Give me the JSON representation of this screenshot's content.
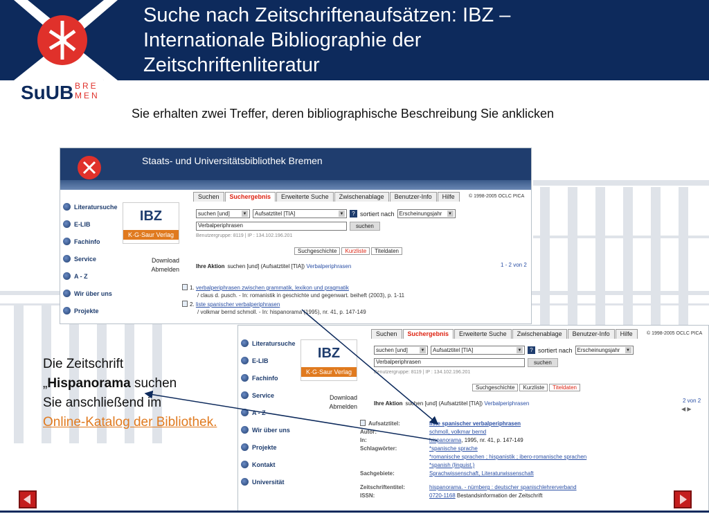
{
  "slide": {
    "title_lines": [
      "Suche nach Zeitschriftenaufsätzen: IBZ –",
      "Internationale Bibliographie der",
      "Zeitschriftenliteratur"
    ],
    "subtitle": "Sie erhalten zwei Treffer, deren bibliographische Beschreibung Sie anklicken",
    "logo": {
      "su": "SuUB",
      "bre": "BRE",
      "men": "MEN"
    },
    "note": {
      "line1": "Die Zeitschrift",
      "quote_open": "„",
      "bold": "Hispanorama",
      "line2_rest": " suchen",
      "line3": "Sie anschließend im",
      "link": "Online-Katalog der Bibliothek."
    },
    "colors": {
      "header": "#0d2a5c",
      "accent": "#c41d1d",
      "link_orange": "#e07a1f"
    }
  },
  "screenshot1": {
    "banner_title": "Staats- und Universitätsbibliothek Bremen",
    "sidebar": [
      "Literatursuche",
      "E-LIB",
      "Fachinfo",
      "Service",
      "A - Z",
      "Wir über uns",
      "Projekte"
    ],
    "ibz": {
      "logo": "IBZ",
      "publisher": "K·G·Saur Verlag"
    },
    "links": [
      "Download",
      "Abmelden"
    ],
    "tabs": [
      "Suchen",
      "Suchergebnis",
      "Erweiterte Suche",
      "Zwischenablage",
      "Benutzer-Info",
      "Hilfe"
    ],
    "copyright": "© 1998-2005 OCLC PICA",
    "form": {
      "op": "suchen [und]",
      "field": "Aufsatztitel [TIA]",
      "sort_label": "sortiert nach",
      "sort": "Erscheinungsjahr",
      "query": "Verbalperiphrasen",
      "button": "suchen",
      "group": "Benutzergruppe: 8119 | IP : 134.102.196.201"
    },
    "subtabs": [
      "Suchgeschichte",
      "Kurzliste",
      "Titeldaten"
    ],
    "action": {
      "label": "Ihre Aktion",
      "text": "suchen [und] (Aufsatztitel [TIA])",
      "term": "Verbalperiphrasen"
    },
    "hits": "1 - 2 von 2",
    "results": [
      {
        "num": "1.",
        "title": "verbalperiphrasen zwischen grammatik, lexikon und pragmatik",
        "detail": "/ claus d. pusch. - In: romanistik in geschichte und gegenwart. beiheft (2003), p. 1-11"
      },
      {
        "num": "2.",
        "title": "liste spanischer verbalperiphrasen",
        "detail": "/ volkmar bernd schmoll. - In: hispanorama (1995), nr. 41, p. 147-149"
      }
    ]
  },
  "screenshot2": {
    "sidebar": [
      "Literatursuche",
      "E-LIB",
      "Fachinfo",
      "Service",
      "A - Z",
      "Wir über uns",
      "Projekte",
      "Kontakt",
      "Universität"
    ],
    "tabs": [
      "Suchen",
      "Suchergebnis",
      "Erweiterte Suche",
      "Zwischenablage",
      "Benutzer-Info",
      "Hilfe"
    ],
    "copyright": "© 1998-2005 OCLC PICA",
    "ibz": {
      "logo": "IBZ",
      "publisher": "K·G·Saur Verlag"
    },
    "links": [
      "Download",
      "Abmelden"
    ],
    "form": {
      "op": "suchen [und]",
      "field": "Aufsatztitel [TIA]",
      "sort_label": "sortiert nach",
      "sort": "Erscheinungsjahr",
      "query": "Verbalperiphrasen",
      "button": "suchen",
      "group": "Benutzergruppe: 8119 | IP : 134.102.196.201"
    },
    "subtabs": [
      "Suchgeschichte",
      "Kurzliste",
      "Titeldaten"
    ],
    "action": {
      "label": "Ihre Aktion",
      "text": "suchen [und] (Aufsatztitel [TIA])",
      "term": "Verbalperiphrasen"
    },
    "hits": "2 von 2",
    "hit_arrows": "◀ ▶",
    "fields": [
      {
        "label": "Aufsatztitel:",
        "value": "liste spanischer verbalperiphrasen",
        "link": true
      },
      {
        "label": "Autor:",
        "value": "schmoll, volkmar bernd",
        "link": true
      },
      {
        "label": "In:",
        "value_link": "hispanorama",
        "value_rest": ", 1995, nr. 41, p. 147-149"
      },
      {
        "label": "Schlagwörter:",
        "value": "*spanische sprache",
        "link": true
      },
      {
        "label": "",
        "value": "*romanische sprachen ; hispanistik ; ibero-romanische sprachen",
        "link": true
      },
      {
        "label": "",
        "value": "*spanish (linguist.)",
        "link": true
      },
      {
        "label": "Sachgebiete:",
        "value": "Sprachwissenschaft, Literaturwissenschaft",
        "link": true
      },
      {
        "label": "Zeitschriftentitel:",
        "value": "hispanorama. - nürnberg : deutscher spanischlehrerverband",
        "link": true
      },
      {
        "label": "ISSN:",
        "value_link": "0720-1168",
        "value_rest": " Bestandsinformation der Zeitschrift"
      }
    ]
  }
}
